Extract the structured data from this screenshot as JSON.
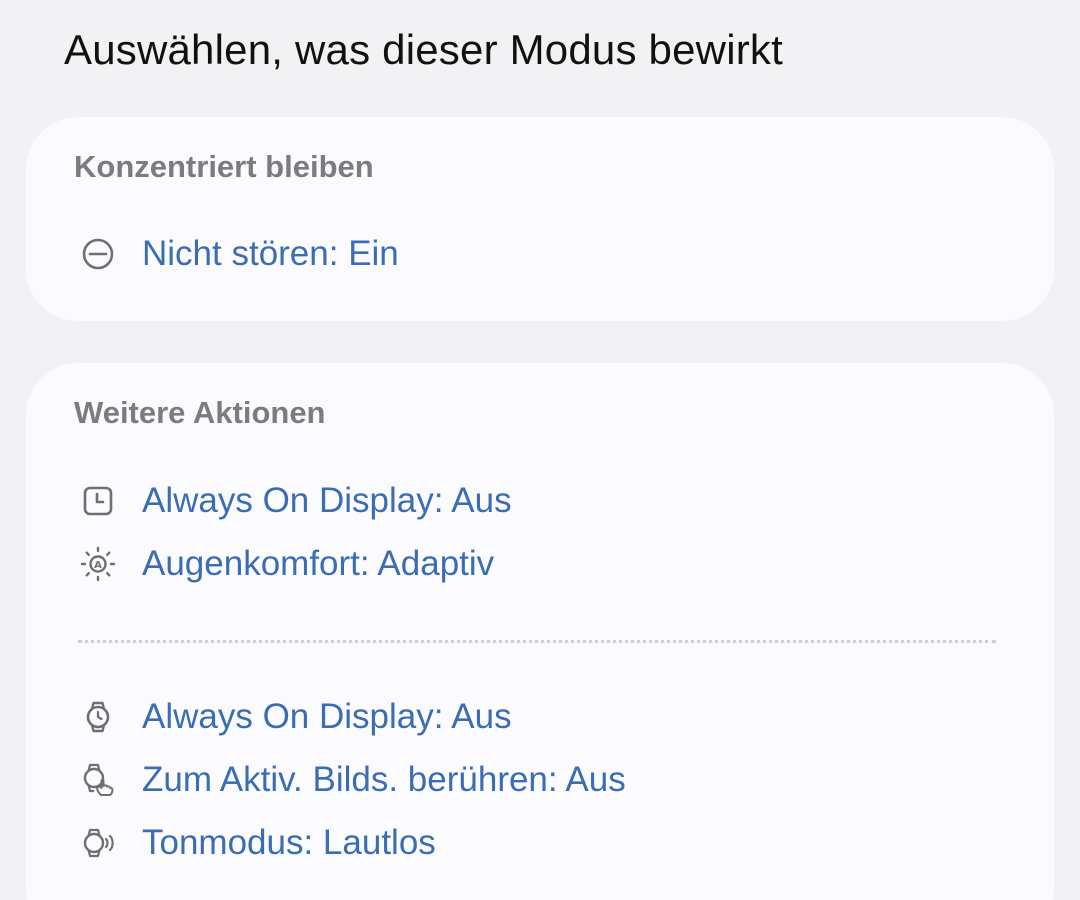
{
  "page": {
    "title": "Auswählen, was dieser Modus bewirkt"
  },
  "sections": {
    "focus": {
      "header": "Konzentriert bleiben",
      "items": [
        {
          "label": "Nicht stören: Ein",
          "icon": "do-not-disturb-icon"
        }
      ]
    },
    "more": {
      "header": "Weitere Aktionen",
      "phone_items": [
        {
          "label": "Always On Display: Aus",
          "icon": "clock-icon"
        },
        {
          "label": "Augenkomfort: Adaptiv",
          "icon": "eye-comfort-icon"
        }
      ],
      "watch_items": [
        {
          "label": "Always On Display: Aus",
          "icon": "watch-icon"
        },
        {
          "label": "Zum Aktiv. Bilds. berühren: Aus",
          "icon": "watch-touch-icon"
        },
        {
          "label": "Tonmodus: Lautlos",
          "icon": "watch-sound-icon"
        }
      ]
    }
  },
  "colors": {
    "background": "#f2f2f4",
    "card": "#fbfbfd",
    "accent_text": "#3b6db3",
    "header_text": "#7c7c80",
    "icon": "#6f6f73"
  }
}
